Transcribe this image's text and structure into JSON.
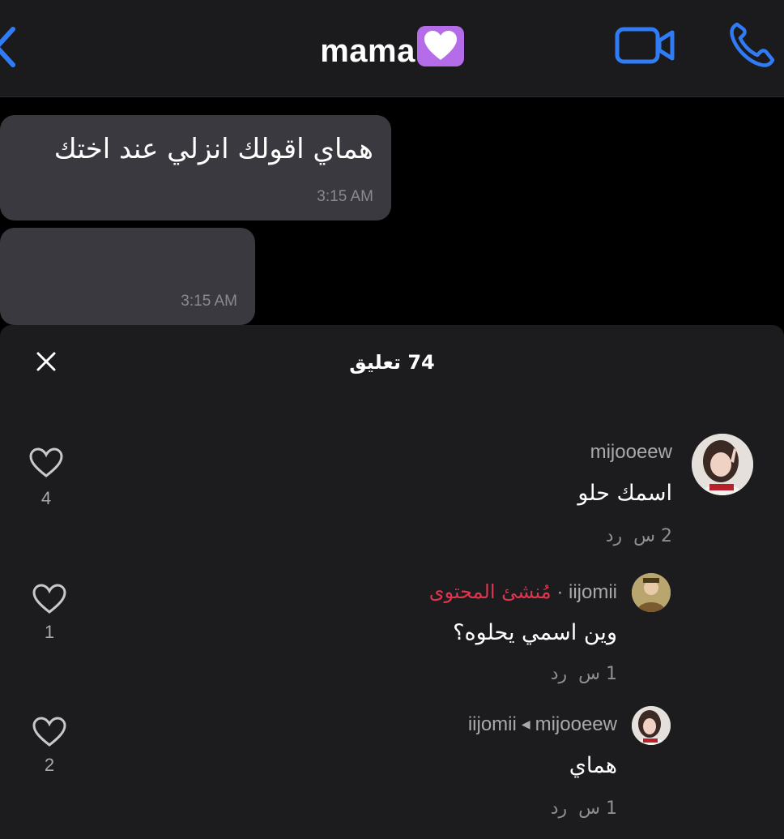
{
  "chat": {
    "contact_name": "mama",
    "header_icons": [
      "back-chevron-icon",
      "purple-heart-emoji",
      "video-call-icon",
      "phone-call-icon"
    ],
    "accent_color": "#2f7cf6",
    "messages": [
      {
        "text": "هماي اقولك انزلي عند اختك",
        "time": "3:15 AM"
      },
      {
        "text": "",
        "time": "3:15 AM"
      }
    ]
  },
  "comments_sheet": {
    "title": "74 تعليق",
    "close_icon": "close-icon",
    "comments": [
      {
        "username": "mijooeew",
        "text": "اسمك حلو",
        "age": "2 س",
        "reply_label": "رد",
        "likes": "4"
      },
      {
        "username": "iijomii",
        "separator": "·",
        "creator_badge": "مُنشئ المحتوى",
        "text": "وين اسمي يحلوه؟",
        "age": "1 س",
        "reply_label": "رد",
        "likes": "1"
      },
      {
        "username": "mijooeew",
        "reply_to": "iijomii",
        "text": "هماي",
        "age": "1 س",
        "reply_label": "رد",
        "likes": "2"
      }
    ]
  }
}
